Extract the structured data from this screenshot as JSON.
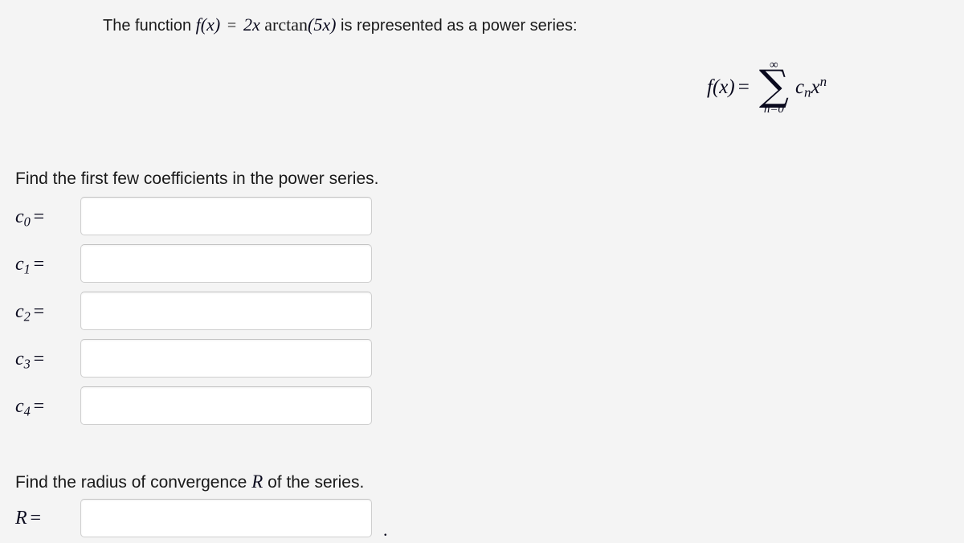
{
  "problem": {
    "statement": {
      "lead": "The function",
      "function_lhs": "f(x)",
      "equals": "=",
      "function_rhs_coefficient": "2x",
      "function_rhs_operator": "arctan",
      "function_rhs_argument": "(5x)",
      "trail": "is represented as a power series:"
    },
    "display_equation": {
      "lhs": "f(x)",
      "equals": "=",
      "sum_upper_limit": "∞",
      "sum_symbol": "∑",
      "sum_lower_limit": "n=0",
      "summand_coefficient": "c",
      "summand_coefficient_index": "n",
      "summand_variable": "x",
      "summand_exponent": "n"
    },
    "coefficients_prompt": "Find the first few coefficients in the power series.",
    "coefficients": [
      {
        "symbol": "c",
        "index": "0",
        "equals": "=",
        "value": "",
        "placeholder": ""
      },
      {
        "symbol": "c",
        "index": "1",
        "equals": "=",
        "value": "",
        "placeholder": ""
      },
      {
        "symbol": "c",
        "index": "2",
        "equals": "=",
        "value": "",
        "placeholder": ""
      },
      {
        "symbol": "c",
        "index": "3",
        "equals": "=",
        "value": "",
        "placeholder": ""
      },
      {
        "symbol": "c",
        "index": "4",
        "equals": "=",
        "value": "",
        "placeholder": ""
      }
    ],
    "radius_prompt_lead": "Find the radius of convergence",
    "radius_prompt_symbol": "R",
    "radius_prompt_trail": "of the series.",
    "radius": {
      "symbol": "R",
      "equals": "=",
      "value": "",
      "placeholder": "",
      "trailing_punctuation": "."
    }
  },
  "colors": {
    "page_background": "#f4f4f4",
    "text": "#1a1a1a",
    "math_text": "#0a0a1e",
    "input_background": "#ffffff",
    "input_border": "#cfcfcf"
  }
}
